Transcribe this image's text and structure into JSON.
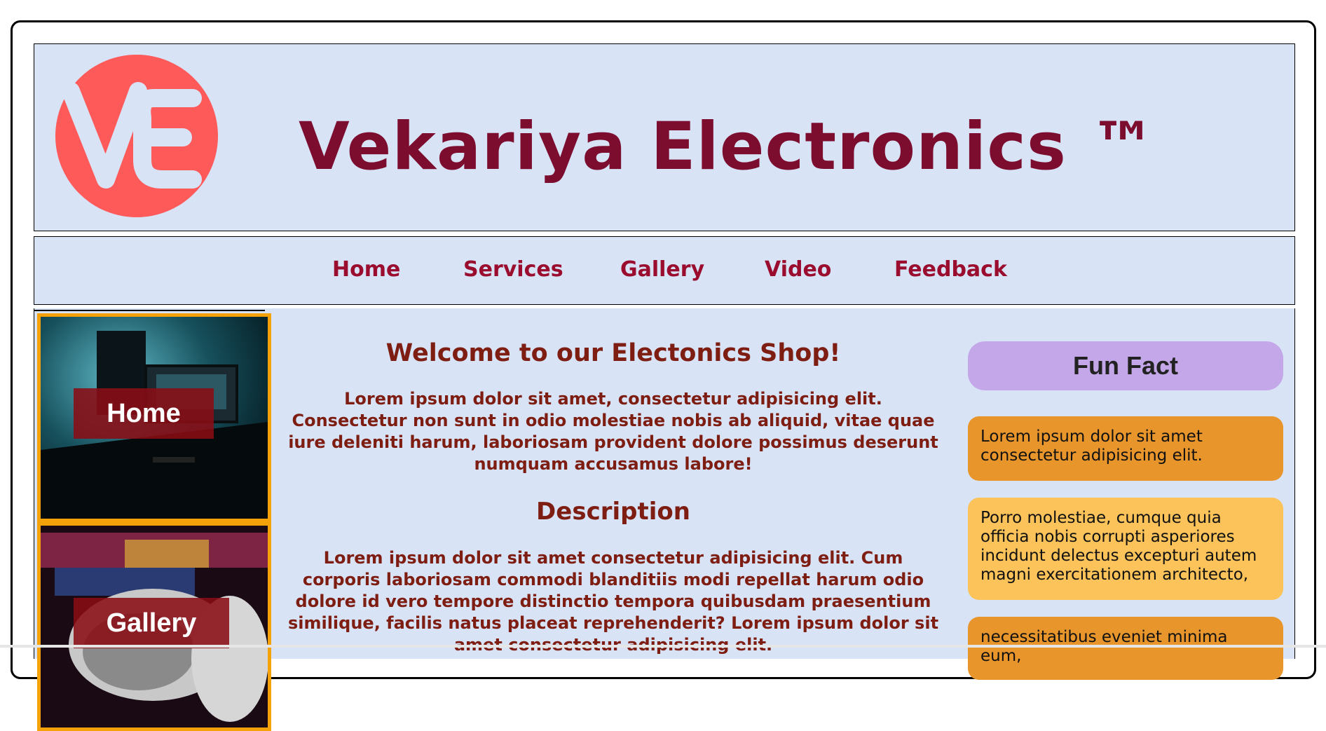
{
  "header": {
    "logo_text": "VE",
    "site_title": "Vekariya Electronics ™",
    "colors": {
      "logo": "#ff5a5a",
      "title": "#7c0d2f",
      "background": "#d8e3f6"
    }
  },
  "nav": {
    "items": [
      {
        "label": "Home"
      },
      {
        "label": "Services"
      },
      {
        "label": "Gallery"
      },
      {
        "label": "Video"
      },
      {
        "label": "Feedback"
      }
    ]
  },
  "sidebar": {
    "tiles": [
      {
        "label": "Home",
        "image": "desk-computer-setup"
      },
      {
        "label": "Gallery",
        "image": "headphones"
      }
    ],
    "border_color": "#f5a20a"
  },
  "main": {
    "welcome_heading": "Welcome to our Electonics Shop!",
    "welcome_text": "Lorem ipsum dolor sit amet, consectetur adipisicing elit. Consectetur non sunt in odio molestiae nobis ab aliquid, vitae quae iure deleniti harum, laboriosam provident dolore possimus deserunt numquam accusamus labore!",
    "description_heading": "Description",
    "description_text": "Lorem ipsum dolor sit amet consectetur adipisicing elit. Cum corporis laboriosam commodi blanditiis modi repellat harum odio dolore id vero tempore distinctio tempora quibusdam praesentium similique, facilis natus placeat reprehenderit? Lorem ipsum dolor sit amet consectetur adipisicing elit."
  },
  "fun_fact": {
    "title": "Fun Fact",
    "facts": [
      "Lorem ipsum dolor sit amet consectetur adipisicing elit.",
      "Porro molestiae, cumque quia officia nobis corrupti asperiores incidunt delectus excepturi autem magni exercitationem architecto,",
      "necessitatibus eveniet minima eum,"
    ]
  }
}
